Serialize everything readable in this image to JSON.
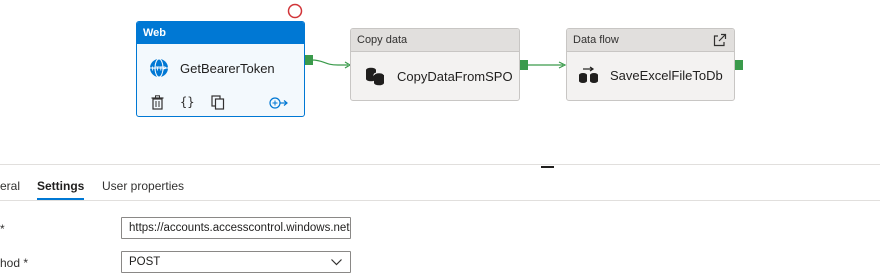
{
  "activities": {
    "web": {
      "type_label": "Web",
      "name": "GetBearerToken",
      "icon": "http-globe-icon"
    },
    "copy": {
      "type_label": "Copy data",
      "name": "CopyDataFromSPO",
      "icon": "database-icon"
    },
    "flow": {
      "type_label": "Data flow",
      "name": "SaveExcelFileToDb",
      "icon": "dataflow-icon"
    }
  },
  "web_actions": {
    "delete": "delete-icon",
    "code": "{}",
    "copy": "copy-icon",
    "add_output": "add-output-icon"
  },
  "tabs": [
    "eral",
    "Settings",
    "User properties"
  ],
  "active_tab": "Settings",
  "settings": {
    "url_label": "*",
    "url_value": "https://accounts.accesscontrol.windows.net",
    "method_label": "hod *",
    "method_value": "POST"
  },
  "colors": {
    "accent": "#0078d4",
    "port": "#3a9a4b",
    "error": "#d13438"
  }
}
